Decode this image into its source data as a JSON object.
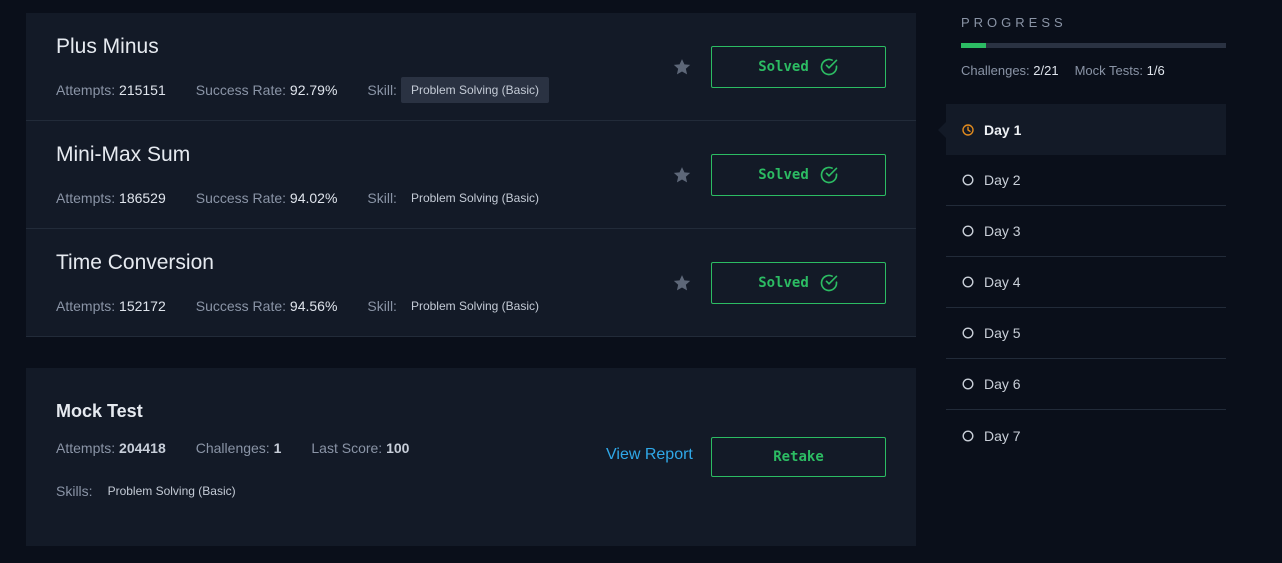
{
  "challenges": [
    {
      "title": "Plus Minus",
      "attempts_label": "Attempts:",
      "attempts": "215151",
      "success_label": "Success Rate:",
      "success_rate": "92.79%",
      "skill_label": "Skill:",
      "skill": "Problem Solving (Basic)",
      "status": "Solved"
    },
    {
      "title": "Mini-Max Sum",
      "attempts_label": "Attempts:",
      "attempts": "186529",
      "success_label": "Success Rate:",
      "success_rate": "94.02%",
      "skill_label": "Skill:",
      "skill": "Problem Solving (Basic)",
      "status": "Solved"
    },
    {
      "title": "Time Conversion",
      "attempts_label": "Attempts:",
      "attempts": "152172",
      "success_label": "Success Rate:",
      "success_rate": "94.56%",
      "skill_label": "Skill:",
      "skill": "Problem Solving (Basic)",
      "status": "Solved"
    }
  ],
  "mock_test": {
    "title": "Mock Test",
    "attempts_label": "Attempts:",
    "attempts": "204418",
    "challenges_label": "Challenges:",
    "challenges": "1",
    "last_score_label": "Last Score:",
    "last_score": "100",
    "skills_label": "Skills:",
    "skill": "Problem Solving (Basic)",
    "view_report": "View Report",
    "retake": "Retake"
  },
  "progress": {
    "title": "PROGRESS",
    "fraction": 0.095,
    "challenges_label": "Challenges:",
    "challenges": "2/21",
    "mock_label": "Mock Tests:",
    "mock": "1/6"
  },
  "days": [
    {
      "label": "Day 1",
      "active": true,
      "icon": "clock-icon"
    },
    {
      "label": "Day 2",
      "active": false,
      "icon": "circle-icon"
    },
    {
      "label": "Day 3",
      "active": false,
      "icon": "circle-icon"
    },
    {
      "label": "Day 4",
      "active": false,
      "icon": "circle-icon"
    },
    {
      "label": "Day 5",
      "active": false,
      "icon": "circle-icon"
    },
    {
      "label": "Day 6",
      "active": false,
      "icon": "circle-icon"
    },
    {
      "label": "Day 7",
      "active": false,
      "icon": "circle-icon"
    }
  ],
  "colors": {
    "accent_green": "#2cbc63",
    "link_blue": "#2fa8e8",
    "active_orange": "#e08a1e"
  }
}
